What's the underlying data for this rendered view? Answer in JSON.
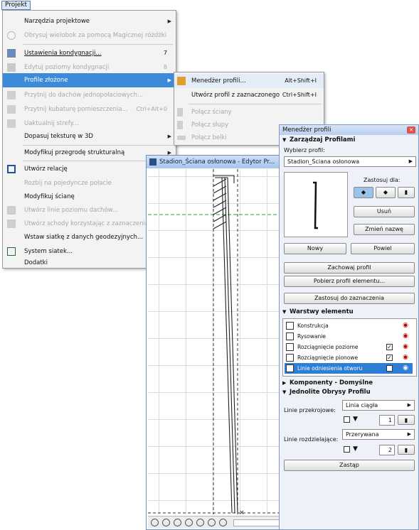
{
  "menubar": {
    "title": "Projekt"
  },
  "menu": {
    "items": [
      {
        "label": "Narzędzia projektowe",
        "disabled": false,
        "arrow": true
      },
      {
        "label": "Obrysuj wielobok za pomocą Magicznej różdżki",
        "disabled": true
      },
      {
        "label": "Ustawienia kondygnacji...",
        "shortcut": "7",
        "disabled": false
      },
      {
        "label": "Edytuj poziomy kondygnacji",
        "shortcut": "8",
        "disabled": true
      },
      {
        "label": "Profile złożone",
        "disabled": false,
        "highlighted": true,
        "arrow": true
      },
      {
        "label": "Przytnij do dachów jednopołaciowych...",
        "disabled": true
      },
      {
        "label": "Przytnij kubaturę pomieszczenia...",
        "shortcut": "Ctrl+Alt+0",
        "disabled": true
      },
      {
        "label": "Uaktualnij strefy...",
        "disabled": true
      },
      {
        "label": "Dopasuj teksturę w 3D",
        "disabled": false,
        "arrow": true
      },
      {
        "label": "Modyfikuj przegrodę strukturalną",
        "disabled": false,
        "arrow": true
      },
      {
        "label": "Utwórz relację",
        "disabled": false
      },
      {
        "label": "Rozbij na pojedyncze połacie",
        "disabled": true
      },
      {
        "label": "Modyfikuj ścianę",
        "disabled": false
      },
      {
        "label": "Utwórz linie poziomu dachów...",
        "disabled": true
      },
      {
        "label": "Utwórz schody korzystając z zaznaczenia",
        "disabled": true
      },
      {
        "label": "Wstaw siatkę z danych geodezyjnych...",
        "disabled": false
      },
      {
        "label": "System siatek...",
        "disabled": false
      },
      {
        "label": "Dodatki",
        "disabled": false
      }
    ]
  },
  "submenu": {
    "items": [
      {
        "label": "Menedżer profili...",
        "shortcut": "Alt+Shift+I",
        "disabled": false
      },
      {
        "label": "Utwórz profil z zaznaczonego",
        "shortcut": "Ctrl+Shift+I",
        "disabled": false
      },
      {
        "label": "Połącz ściany",
        "disabled": true
      },
      {
        "label": "Połącz słupy",
        "disabled": true
      },
      {
        "label": "Połącz belki",
        "disabled": true
      }
    ]
  },
  "editor": {
    "title": "Stadion_Ściana osłonowa - Edytor Pr..."
  },
  "profile_manager": {
    "title": "Menedżer profili",
    "section_manage": "Zarządzaj Profilami",
    "choose_profile_label": "Wybierz profil:",
    "selected_profile": "Stadion_Ściana osłonowa",
    "apply_for_label": "Zastosuj dla:",
    "delete_button": "Usuń",
    "rename_button": "Zmień nazwę",
    "new_button": "Nowy",
    "duplicate_button": "Powiel",
    "save_button": "Zachowaj profil",
    "get_profile_button": "Pobierz profil elementu...",
    "apply_selection_button": "Zastosuj do zaznaczenia",
    "section_layers": "Warstwy elementu",
    "layers": [
      {
        "label": "Konstrukcja",
        "checkbox": false,
        "eye": true,
        "selected": false
      },
      {
        "label": "Rysowanie",
        "checkbox": false,
        "eye": true,
        "selected": false
      },
      {
        "label": "Rozciągnięcie poziome",
        "checkbox": true,
        "eye": true,
        "selected": false
      },
      {
        "label": "Rozciągnięcie pionowe",
        "checkbox": true,
        "eye": true,
        "selected": false
      },
      {
        "label": "Linie odniesienia otworu",
        "checkbox": true,
        "eye": true,
        "selected": true
      }
    ],
    "section_components": "Komponenty - Domyślne",
    "section_contours": "Jednolite Obrysy Profilu",
    "cut_lines_label": "Linie przekrojowe:",
    "cut_lines_value": "Linia ciągła",
    "cut_pen": "1",
    "separator_lines_label": "Linie rozdzielające:",
    "separator_lines_value": "Przerywana",
    "separator_pen": "2",
    "save_apply_button": "Zastąp"
  },
  "colors": {
    "highlight": "#3d8ad8",
    "guide_green": "#2e9b3a"
  }
}
